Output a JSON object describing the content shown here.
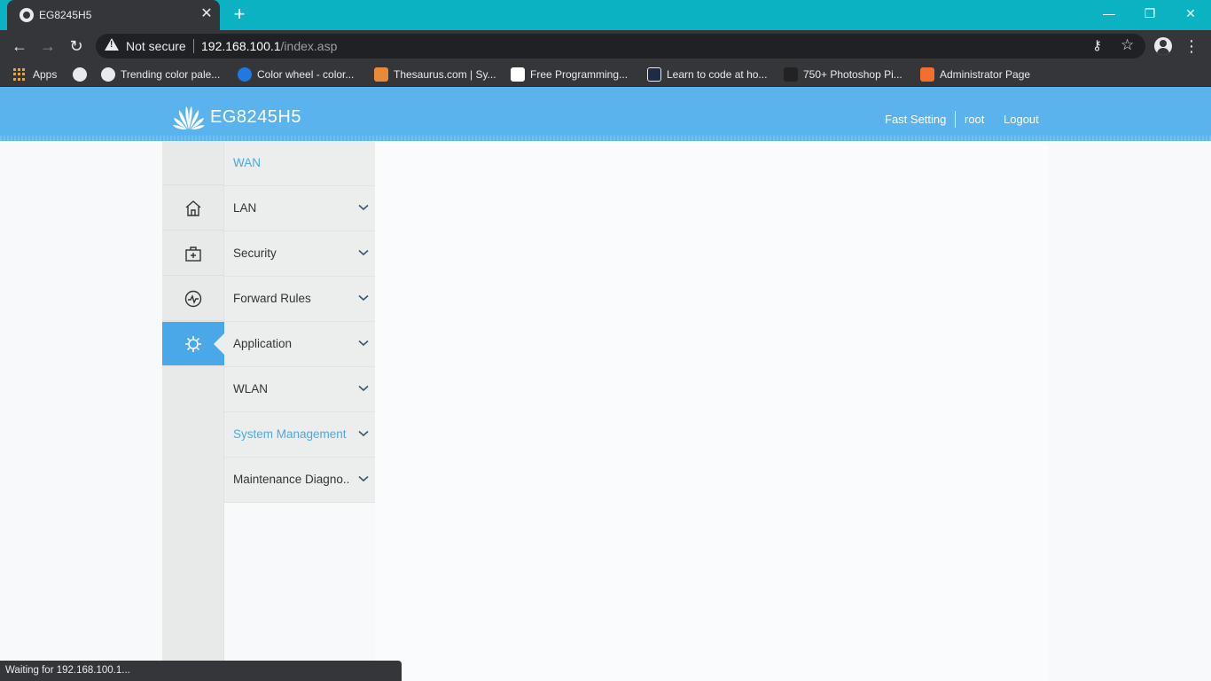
{
  "browser": {
    "tab_title": "EG8245H5",
    "tab_close": "✕",
    "new_tab": "+",
    "window_controls": {
      "minimize": "—",
      "restore": "❐",
      "close": "✕"
    },
    "security_label": "Not secure",
    "url_host": "192.168.100.1",
    "url_path": "/index.asp",
    "bookmarks": [
      {
        "label": "Apps",
        "icon": "apps-grid-icon"
      },
      {
        "label": "",
        "icon": "globe-icon"
      },
      {
        "label": "Trending color pale...",
        "icon": "coolors-icon"
      },
      {
        "label": "Color wheel - color...",
        "icon": "canva-icon"
      },
      {
        "label": "Thesaurus.com | Sy...",
        "icon": "thesaurus-icon"
      },
      {
        "label": "Free Programming...",
        "icon": "freecodecamp-icon"
      },
      {
        "label": "Learn to code at ho...",
        "icon": "codecademy-icon"
      },
      {
        "label": "750+ Photoshop Pi...",
        "icon": "photoshop-icon"
      },
      {
        "label": "Administrator Page",
        "icon": "xampp-icon"
      }
    ],
    "status_text": "Waiting for 192.168.100.1..."
  },
  "router": {
    "product_name": "EG8245H5",
    "header_links": {
      "fast_setting": "Fast Setting",
      "user": "root",
      "logout": "Logout"
    },
    "menu": [
      {
        "label": "WAN",
        "highlight": true,
        "expandable": false
      },
      {
        "label": "LAN",
        "highlight": false,
        "expandable": true
      },
      {
        "label": "Security",
        "highlight": false,
        "expandable": true
      },
      {
        "label": "Forward Rules",
        "highlight": false,
        "expandable": true
      },
      {
        "label": "Application",
        "highlight": false,
        "expandable": true
      },
      {
        "label": "WLAN",
        "highlight": false,
        "expandable": true
      },
      {
        "label": "System Management",
        "highlight": true,
        "expandable": true
      },
      {
        "label": "Maintenance Diagno..",
        "highlight": false,
        "expandable": true
      }
    ],
    "rail_icons": [
      "home-icon",
      "medical-kit-icon",
      "pulse-icon",
      "gear-icon"
    ],
    "colors": {
      "header_blue": "#5bb3ee",
      "accent_blue": "#4aa8e8",
      "tab_strip": "#0bb3c2"
    }
  }
}
